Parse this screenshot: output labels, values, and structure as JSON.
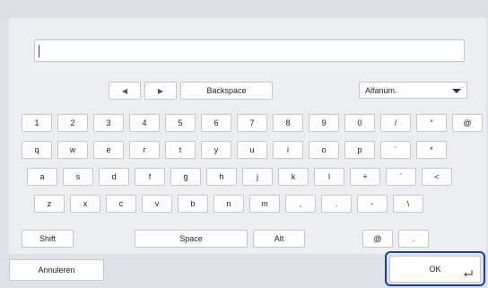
{
  "keyboard": {
    "nav": {
      "left_icon": "◀",
      "right_icon": "▶",
      "backspace": "Backspace"
    },
    "mode": {
      "selected": "Alfanum."
    },
    "row1": [
      "1",
      "2",
      "3",
      "4",
      "5",
      "6",
      "7",
      "8",
      "9",
      "0",
      "/",
      "°",
      "@"
    ],
    "row2": [
      "q",
      "w",
      "e",
      "r",
      "t",
      "y",
      "u",
      "i",
      "o",
      "p",
      "¨",
      "*"
    ],
    "row3": [
      "a",
      "s",
      "d",
      "f",
      "g",
      "h",
      "j",
      "k",
      "l",
      "+",
      "´",
      "<"
    ],
    "row4": [
      "z",
      "x",
      "c",
      "v",
      "b",
      "n",
      "m",
      ",",
      ".",
      "-",
      "\\"
    ],
    "row5": {
      "shift": "Shift",
      "space": "Space",
      "alt": "Alt",
      "at": "@",
      "dot": "."
    }
  },
  "footer": {
    "cancel": "Annuleren",
    "ok": "OK"
  },
  "colors": {
    "focus_ring": "#1a3fa6",
    "background": "#dfe2e8"
  }
}
